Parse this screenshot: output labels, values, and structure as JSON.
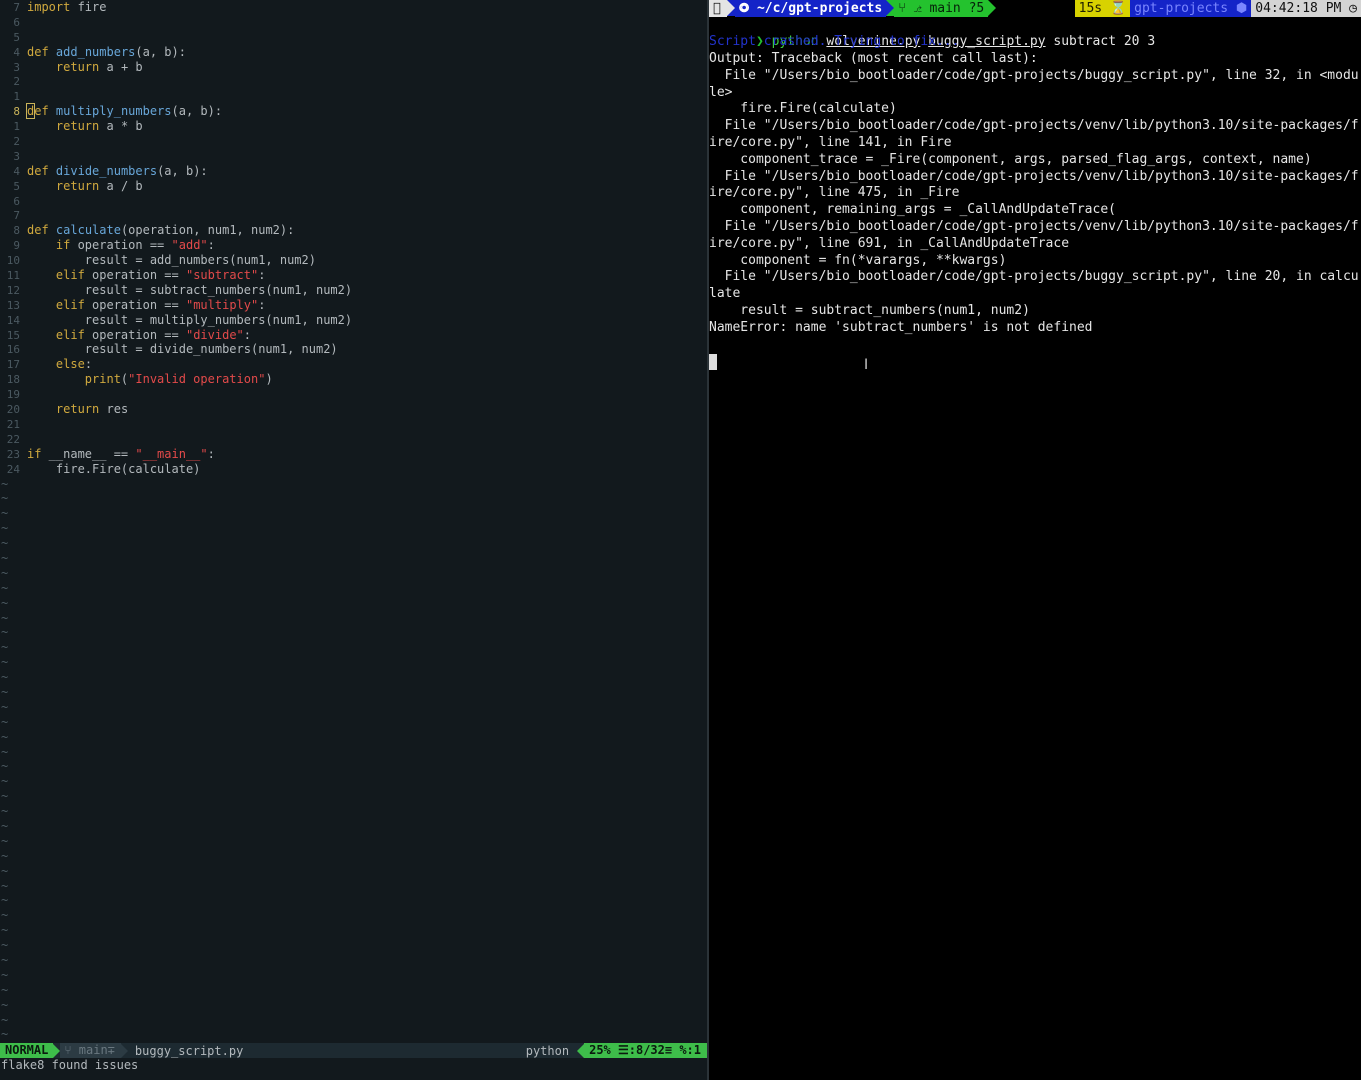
{
  "editor": {
    "lines": [
      {
        "num": "7",
        "tokens": [
          {
            "t": "kw",
            "v": "import"
          },
          {
            "t": "txt",
            "v": " fire"
          }
        ]
      },
      {
        "num": "6",
        "tokens": []
      },
      {
        "num": "5",
        "tokens": []
      },
      {
        "num": "4",
        "tokens": [
          {
            "t": "kw",
            "v": "def"
          },
          {
            "t": "txt",
            "v": " "
          },
          {
            "t": "fn",
            "v": "add_numbers"
          },
          {
            "t": "txt",
            "v": "(a, b):"
          }
        ]
      },
      {
        "num": "3",
        "tokens": [
          {
            "t": "txt",
            "v": "    "
          },
          {
            "t": "kw",
            "v": "return"
          },
          {
            "t": "txt",
            "v": " a + b"
          }
        ]
      },
      {
        "num": "2",
        "tokens": []
      },
      {
        "num": "1",
        "tokens": []
      },
      {
        "num": "8",
        "current": true,
        "tokens": [
          {
            "t": "kw",
            "v": "def",
            "cursor": true
          },
          {
            "t": "txt",
            "v": " "
          },
          {
            "t": "fn",
            "v": "multiply_numbers"
          },
          {
            "t": "txt",
            "v": "(a, b):"
          }
        ]
      },
      {
        "num": "1",
        "tokens": [
          {
            "t": "txt",
            "v": "    "
          },
          {
            "t": "kw",
            "v": "return"
          },
          {
            "t": "txt",
            "v": " a * b"
          }
        ]
      },
      {
        "num": "2",
        "tokens": []
      },
      {
        "num": "3",
        "tokens": []
      },
      {
        "num": "4",
        "tokens": [
          {
            "t": "kw",
            "v": "def"
          },
          {
            "t": "txt",
            "v": " "
          },
          {
            "t": "fn",
            "v": "divide_numbers"
          },
          {
            "t": "txt",
            "v": "(a, b):"
          }
        ]
      },
      {
        "num": "5",
        "tokens": [
          {
            "t": "txt",
            "v": "    "
          },
          {
            "t": "kw",
            "v": "return"
          },
          {
            "t": "txt",
            "v": " a / b"
          }
        ]
      },
      {
        "num": "6",
        "tokens": []
      },
      {
        "num": "7",
        "tokens": []
      },
      {
        "num": "8",
        "tokens": [
          {
            "t": "kw",
            "v": "def"
          },
          {
            "t": "txt",
            "v": " "
          },
          {
            "t": "fn",
            "v": "calculate"
          },
          {
            "t": "txt",
            "v": "(operation, num1, num2):"
          }
        ]
      },
      {
        "num": "9",
        "tokens": [
          {
            "t": "txt",
            "v": "    "
          },
          {
            "t": "kw",
            "v": "if"
          },
          {
            "t": "txt",
            "v": " operation == "
          },
          {
            "t": "str",
            "v": "\"add\""
          },
          {
            "t": "txt",
            "v": ":"
          }
        ]
      },
      {
        "num": "10",
        "tokens": [
          {
            "t": "txt",
            "v": "        result = add_numbers(num1, num2)"
          }
        ]
      },
      {
        "num": "11",
        "tokens": [
          {
            "t": "txt",
            "v": "    "
          },
          {
            "t": "kw",
            "v": "elif"
          },
          {
            "t": "txt",
            "v": " operation == "
          },
          {
            "t": "str",
            "v": "\"subtract\""
          },
          {
            "t": "txt",
            "v": ":"
          }
        ]
      },
      {
        "num": "12",
        "tokens": [
          {
            "t": "txt",
            "v": "        result = subtract_numbers(num1, num2)"
          }
        ]
      },
      {
        "num": "13",
        "tokens": [
          {
            "t": "txt",
            "v": "    "
          },
          {
            "t": "kw",
            "v": "elif"
          },
          {
            "t": "txt",
            "v": " operation == "
          },
          {
            "t": "str",
            "v": "\"multiply\""
          },
          {
            "t": "txt",
            "v": ":"
          }
        ]
      },
      {
        "num": "14",
        "tokens": [
          {
            "t": "txt",
            "v": "        result = multiply_numbers(num1, num2)"
          }
        ]
      },
      {
        "num": "15",
        "tokens": [
          {
            "t": "txt",
            "v": "    "
          },
          {
            "t": "kw",
            "v": "elif"
          },
          {
            "t": "txt",
            "v": " operation == "
          },
          {
            "t": "str",
            "v": "\"divide\""
          },
          {
            "t": "txt",
            "v": ":"
          }
        ]
      },
      {
        "num": "16",
        "tokens": [
          {
            "t": "txt",
            "v": "        result = divide_numbers(num1, num2)"
          }
        ]
      },
      {
        "num": "17",
        "tokens": [
          {
            "t": "txt",
            "v": "    "
          },
          {
            "t": "kw",
            "v": "else"
          },
          {
            "t": "txt",
            "v": ":"
          }
        ]
      },
      {
        "num": "18",
        "tokens": [
          {
            "t": "txt",
            "v": "        "
          },
          {
            "t": "kw",
            "v": "print"
          },
          {
            "t": "txt",
            "v": "("
          },
          {
            "t": "str",
            "v": "\"Invalid operation\""
          },
          {
            "t": "txt",
            "v": ")"
          }
        ]
      },
      {
        "num": "19",
        "tokens": []
      },
      {
        "num": "20",
        "tokens": [
          {
            "t": "txt",
            "v": "    "
          },
          {
            "t": "kw",
            "v": "return"
          },
          {
            "t": "txt",
            "v": " res"
          }
        ]
      },
      {
        "num": "21",
        "tokens": []
      },
      {
        "num": "22",
        "tokens": []
      },
      {
        "num": "23",
        "tokens": [
          {
            "t": "kw",
            "v": "if"
          },
          {
            "t": "txt",
            "v": " __name__ == "
          },
          {
            "t": "str",
            "v": "\"__main__\""
          },
          {
            "t": "txt",
            "v": ":"
          }
        ]
      },
      {
        "num": "24",
        "tokens": [
          {
            "t": "txt",
            "v": "    fire.Fire(calculate)"
          }
        ]
      }
    ],
    "tilde_count": 38,
    "tilde_char": "~"
  },
  "statusline": {
    "mode": "NORMAL",
    "branch": "⑂ main∓",
    "filename": "buggy_script.py",
    "filetype": "python",
    "position": "25% ☰:8/32≡ %:1"
  },
  "message_line": "flake8 found issues",
  "terminal": {
    "prompt_bar": {
      "os_icon": "",
      "dir": "⭗ ~/c/gpt-projects",
      "git": "⑂ ⎇ main ?5",
      "took": "15s ⌛",
      "venv": "gpt-projects ⬢",
      "clock": "04:42:18 PM ◷"
    },
    "command": {
      "chevron": "❯",
      "program": "python",
      "arg1": "wolverine.py",
      "arg2": "buggy_script.py",
      "rest": "subtract 20 3"
    },
    "crash_note": "Script crashed. Trying to fix...",
    "output": [
      "Output: Traceback (most recent call last):",
      "  File \"/Users/bio_bootloader/code/gpt-projects/buggy_script.py\", line 32, in <modu",
      "le>",
      "    fire.Fire(calculate)",
      "  File \"/Users/bio_bootloader/code/gpt-projects/venv/lib/python3.10/site-packages/f",
      "ire/core.py\", line 141, in Fire",
      "    component_trace = _Fire(component, args, parsed_flag_args, context, name)",
      "  File \"/Users/bio_bootloader/code/gpt-projects/venv/lib/python3.10/site-packages/f",
      "ire/core.py\", line 475, in _Fire",
      "    component, remaining_args = _CallAndUpdateTrace(",
      "  File \"/Users/bio_bootloader/code/gpt-projects/venv/lib/python3.10/site-packages/f",
      "ire/core.py\", line 691, in _CallAndUpdateTrace",
      "    component = fn(*varargs, **kwargs)",
      "  File \"/Users/bio_bootloader/code/gpt-projects/buggy_script.py\", line 20, in calcu",
      "late",
      "    result = subtract_numbers(num1, num2)",
      "NameError: name 'subtract_numbers' is not defined"
    ],
    "ibeam_glyph": "I"
  },
  "colors": {
    "editor_bg": "#12191d",
    "keyword": "#d0a93e",
    "function": "#68a6d8",
    "string": "#e24a4a",
    "mode_green": "#3ebd4a",
    "terminal_bg": "#000000",
    "prompt_dir_blue": "#1424c8",
    "prompt_git_green": "#24c22e",
    "prompt_took_yellow": "#d8d200"
  }
}
